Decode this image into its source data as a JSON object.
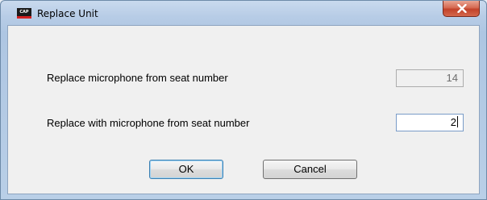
{
  "window": {
    "title": "Replace Unit",
    "app_icon_text": "CAP",
    "icon": "cap-logo-icon",
    "close_icon": "close-icon"
  },
  "form": {
    "from_label": "Replace microphone from seat number",
    "from_value": "14",
    "with_label": "Replace with microphone from seat number",
    "with_value": "2"
  },
  "buttons": {
    "ok_label": "OK",
    "cancel_label": "Cancel"
  },
  "colors": {
    "close_button": "#c2422a",
    "title_bar": "#b7cce6",
    "dialog_background": "#f0f0f0"
  }
}
